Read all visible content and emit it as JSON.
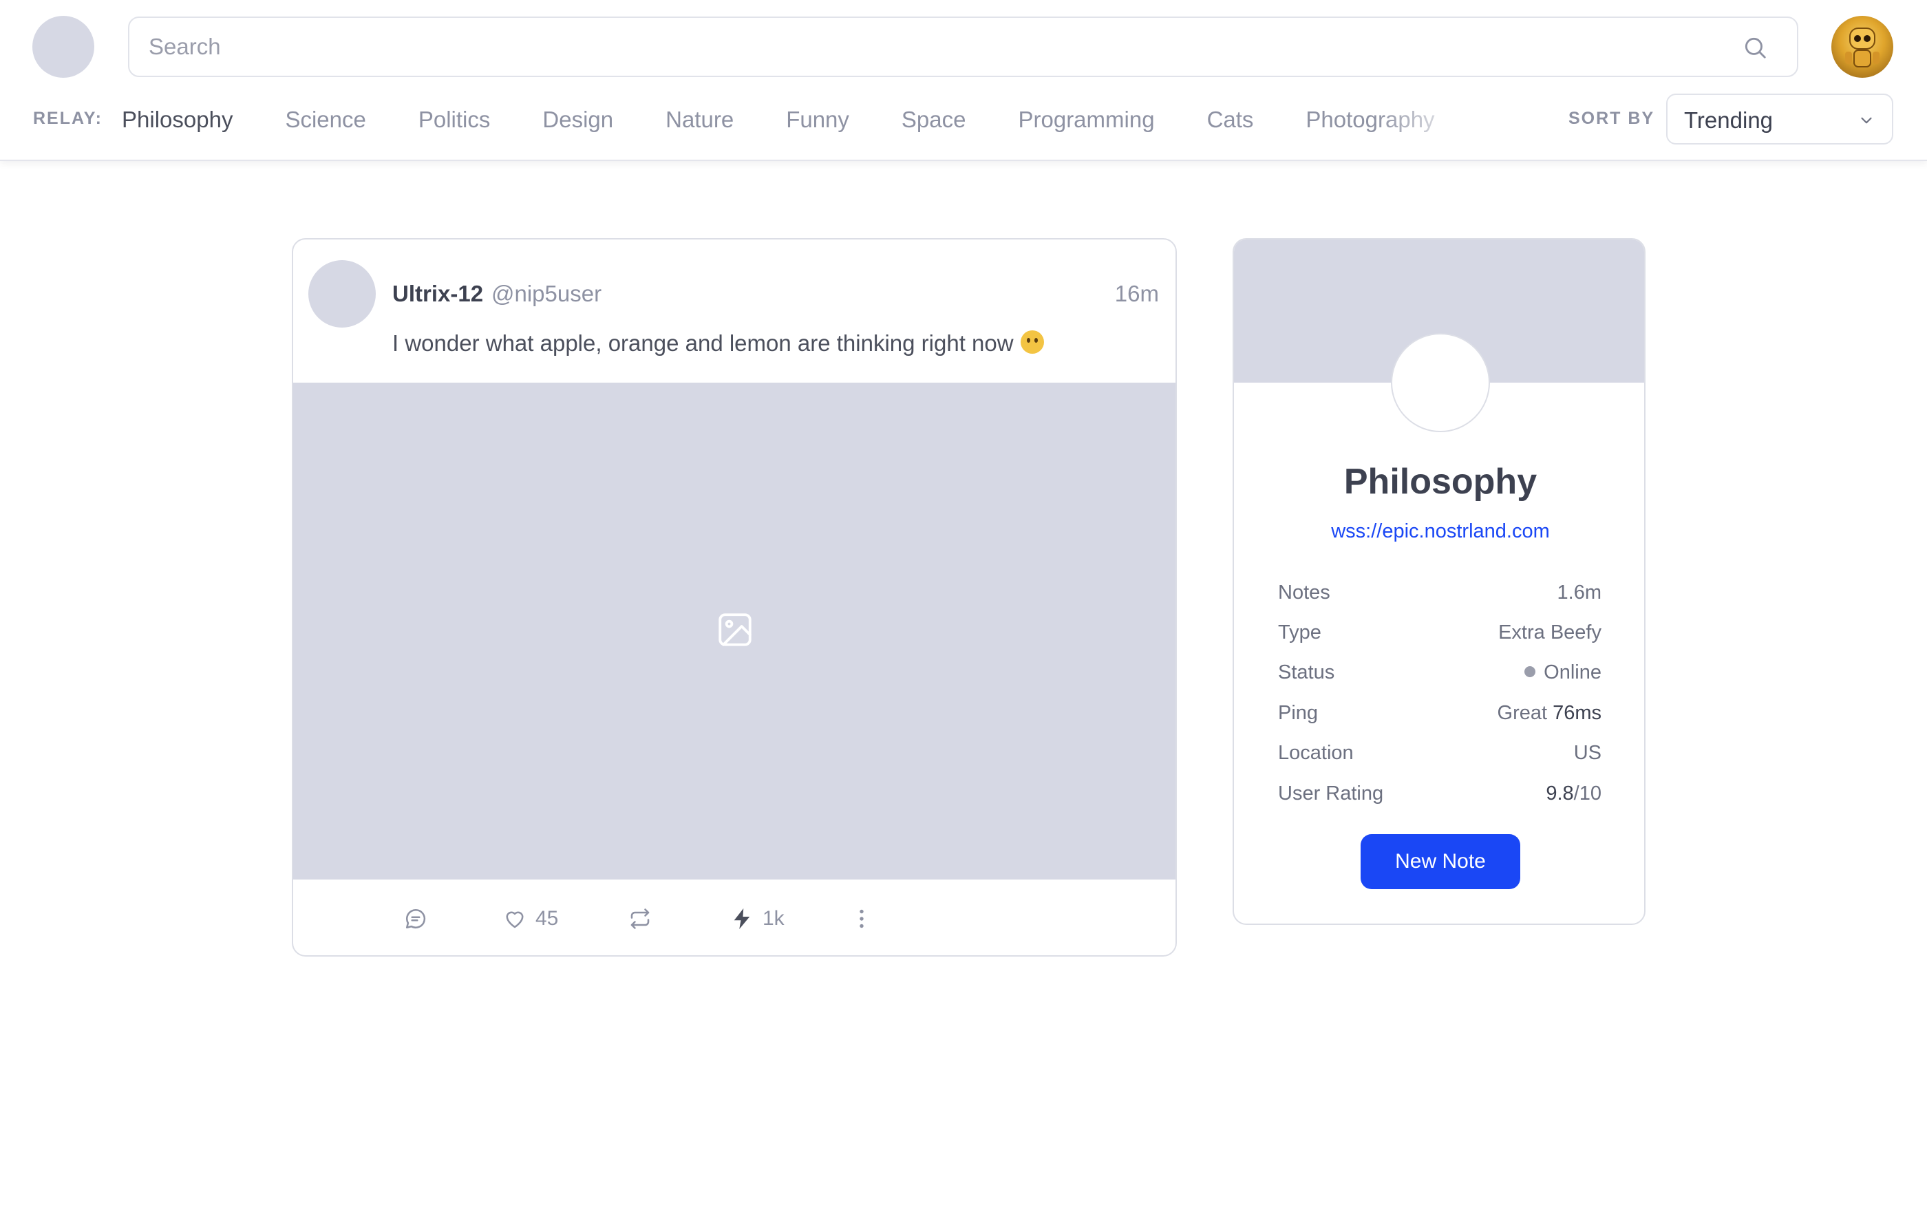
{
  "search": {
    "placeholder": "Search"
  },
  "relay_nav": {
    "label": "RELAY:",
    "tabs": [
      {
        "label": "Philosophy",
        "active": true
      },
      {
        "label": "Science"
      },
      {
        "label": "Politics"
      },
      {
        "label": "Design"
      },
      {
        "label": "Nature"
      },
      {
        "label": "Funny"
      },
      {
        "label": "Space"
      },
      {
        "label": "Programming"
      },
      {
        "label": "Cats"
      },
      {
        "label": "Photography"
      }
    ]
  },
  "sort": {
    "label": "SORT BY",
    "value": "Trending"
  },
  "post": {
    "author": "Ultrix-12",
    "handle": "@nip5user",
    "time": "16m",
    "text": "I wonder what apple, orange and lemon are thinking right now",
    "emoji_icon": "thinking-face-icon",
    "actions": {
      "likes": "45",
      "zaps": "1k"
    }
  },
  "relay": {
    "name": "Philosophy",
    "url": "wss://epic.nostrland.com",
    "stats": {
      "notes": {
        "label": "Notes",
        "value": "1.6m"
      },
      "type": {
        "label": "Type",
        "value": "Extra Beefy"
      },
      "status": {
        "label": "Status",
        "value": "Online"
      },
      "ping": {
        "label": "Ping",
        "quality": "Great",
        "ms": "76ms"
      },
      "location": {
        "label": "Location",
        "value": "US"
      },
      "rating": {
        "label": "User Rating",
        "score": "9.8",
        "max": "/10"
      }
    },
    "new_note_label": "New Note"
  },
  "colors": {
    "accent": "#1a47f5",
    "placeholder_gray": "#d6d8e4",
    "text_dark": "#3d4150",
    "text_muted": "#8e92a3"
  }
}
